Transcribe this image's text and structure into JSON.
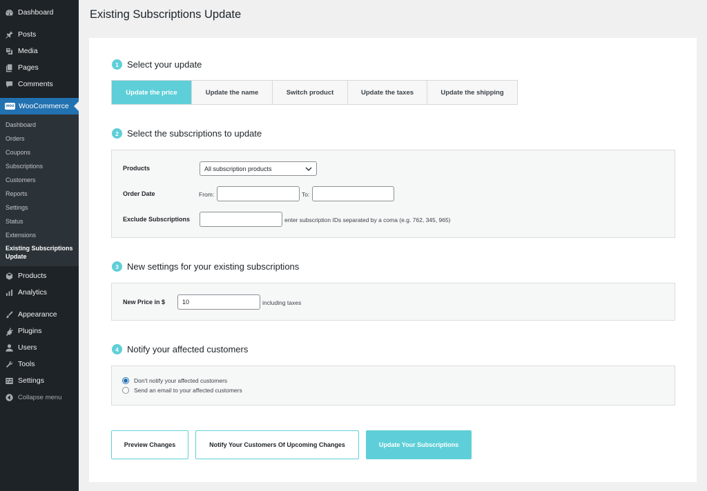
{
  "sidebar": {
    "top_items": [
      {
        "label": "Dashboard",
        "icon": "dashboard-icon"
      },
      {
        "label": "Posts",
        "icon": "pin-icon"
      },
      {
        "label": "Media",
        "icon": "media-icon"
      },
      {
        "label": "Pages",
        "icon": "pages-icon"
      },
      {
        "label": "Comments",
        "icon": "comments-icon"
      }
    ],
    "woocommerce": {
      "label": "WooCommerce",
      "logo_text": "woo"
    },
    "submenu": [
      "Dashboard",
      "Orders",
      "Coupons",
      "Subscriptions",
      "Customers",
      "Reports",
      "Settings",
      "Status",
      "Extensions"
    ],
    "submenu_current": "Existing Subscriptions Update",
    "bottom_items": [
      {
        "label": "Products",
        "icon": "box-icon"
      },
      {
        "label": "Analytics",
        "icon": "chart-icon"
      },
      {
        "label": "Appearance",
        "icon": "brush-icon"
      },
      {
        "label": "Plugins",
        "icon": "plugin-icon"
      },
      {
        "label": "Users",
        "icon": "user-icon"
      },
      {
        "label": "Tools",
        "icon": "wrench-icon"
      },
      {
        "label": "Settings",
        "icon": "settings-icon"
      }
    ],
    "collapse_label": "Collapse menu"
  },
  "page": {
    "title": "Existing Subscriptions Update"
  },
  "step1": {
    "number": "1",
    "title": "Select your update",
    "tabs": [
      "Update the price",
      "Update the name",
      "Switch product",
      "Update the taxes",
      "Update the shipping"
    ],
    "active_tab": "Update the price"
  },
  "step2": {
    "number": "2",
    "title": "Select the subscriptions to update",
    "products_label": "Products",
    "products_value": "All subscription products",
    "order_date_label": "Order Date",
    "from_label": "From:",
    "to_label": "To:",
    "from_value": "",
    "to_value": "",
    "exclude_label": "Exclude Subscriptions",
    "exclude_value": "",
    "exclude_hint": "enter subscription IDs separated by a coma (e.g. 762, 345, 965)"
  },
  "step3": {
    "number": "3",
    "title": "New settings for your existing subscriptions",
    "price_label": "New Price in $",
    "price_value": "10",
    "price_hint": "including taxes"
  },
  "step4": {
    "number": "4",
    "title": "Notify your affected customers",
    "options": [
      "Don't notify your affected customers",
      "Send an email to your affected customers"
    ],
    "selected": 0
  },
  "actions": {
    "preview": "Preview Changes",
    "notify": "Notify Your Customers Of Upcoming Changes",
    "update": "Update Your Subscriptions"
  },
  "colors": {
    "accent": "#5ecfd8",
    "wp_blue": "#2271b1",
    "sidebar_bg": "#1d2327"
  }
}
